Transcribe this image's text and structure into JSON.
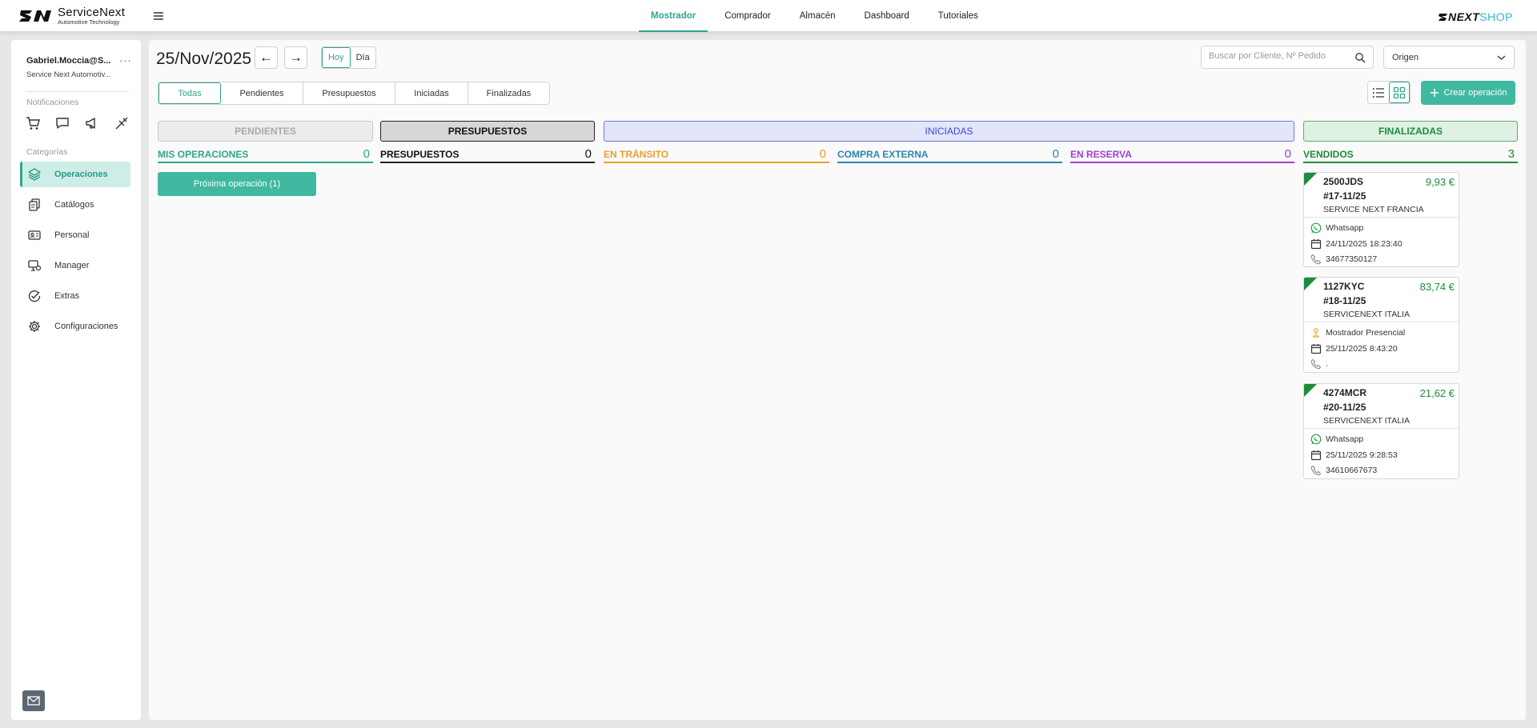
{
  "topbar": {
    "logo_name": "ServiceNext",
    "logo_sub": "Automotive Technology",
    "nav": [
      {
        "label": "Mostrador",
        "active": true
      },
      {
        "label": "Comprador",
        "active": false
      },
      {
        "label": "Almacén",
        "active": false
      },
      {
        "label": "Dashboard",
        "active": false
      },
      {
        "label": "Tutoriales",
        "active": false
      }
    ],
    "brand_right_a": "NEXT",
    "brand_right_b": "SHOP"
  },
  "sidebar": {
    "user_name": "Gabriel.Moccia@S...",
    "user_more": "···",
    "user_company": "Service Next Automotiv...",
    "notifications_label": "Notificaciones",
    "categories_label": "Categorías",
    "items": [
      {
        "label": "Operaciones",
        "icon": "layers-icon",
        "active": true
      },
      {
        "label": "Catálogos",
        "icon": "catalog-icon",
        "active": false
      },
      {
        "label": "Personal",
        "icon": "id-card-icon",
        "active": false
      },
      {
        "label": "Manager",
        "icon": "manager-icon",
        "active": false
      },
      {
        "label": "Extras",
        "icon": "badge-check-icon",
        "active": false
      },
      {
        "label": "Configuraciones",
        "icon": "gear-icon",
        "active": false
      }
    ]
  },
  "main": {
    "date": "25/Nov/2025",
    "prev": "←",
    "next": "→",
    "today_label": "Hoy",
    "day_label": "Día",
    "search_placeholder": "Buscar por Cliente, Nº Pedido",
    "origin_label": "Origen",
    "tabs": [
      "Todas",
      "Pendientes",
      "Presupuestos",
      "Iniciadas",
      "Finalizadas"
    ],
    "create_label": "Crear operación",
    "groups": {
      "pendientes": "PENDIENTES",
      "presupuestos": "PRESUPUESTOS",
      "iniciadas": "INICIADAS",
      "finalizadas": "FINALIZADAS"
    },
    "columns": [
      {
        "label": "MIS OPERACIONES",
        "count": "0",
        "color": "#2fa58e"
      },
      {
        "label": "PRESUPUESTOS",
        "count": "0",
        "color": "#222222"
      },
      {
        "label": "EN TRÁNSITO",
        "count": "0",
        "color": "#e8a02c"
      },
      {
        "label": "COMPRA EXTERNA",
        "count": "0",
        "color": "#2a86b0"
      },
      {
        "label": "EN RESERVA",
        "count": "0",
        "color": "#a040d0"
      },
      {
        "label": "VENDIDOS",
        "count": "3",
        "color": "#1e8c3a"
      }
    ],
    "next_op_label": "Próxima operación (1)",
    "cards": [
      {
        "plate": "2500JDS",
        "price": "9,93 €",
        "number": "#17-11/25",
        "client": "SERVICE NEXT FRANCIA",
        "origin": "Whatsapp",
        "origin_icon": "whatsapp-icon",
        "date": "24/11/2025 18:23:40",
        "phone": "34677350127"
      },
      {
        "plate": "1127KYC",
        "price": "83,74 €",
        "number": "#18-11/25",
        "client": "SERVICENEXT ITALIA",
        "origin": "Mostrador Presencial",
        "origin_icon": "person-location-icon",
        "date": "25/11/2025 8:43:20",
        "phone": "."
      },
      {
        "plate": "4274MCR",
        "price": "21,62 €",
        "number": "#20-11/25",
        "client": "SERVICENEXT ITALIA",
        "origin": "Whatsapp",
        "origin_icon": "whatsapp-icon",
        "date": "25/11/2025 9:28:53",
        "phone": "34610667673"
      }
    ]
  },
  "colors": {
    "accent": "#2fa58e",
    "accent_button": "#40b9a0",
    "vendidos": "#1e8c3a",
    "iniciadas_bg": "#e3e5fb",
    "iniciadas_text": "#3a48d8",
    "finalizadas_bg": "#dff1e3"
  }
}
